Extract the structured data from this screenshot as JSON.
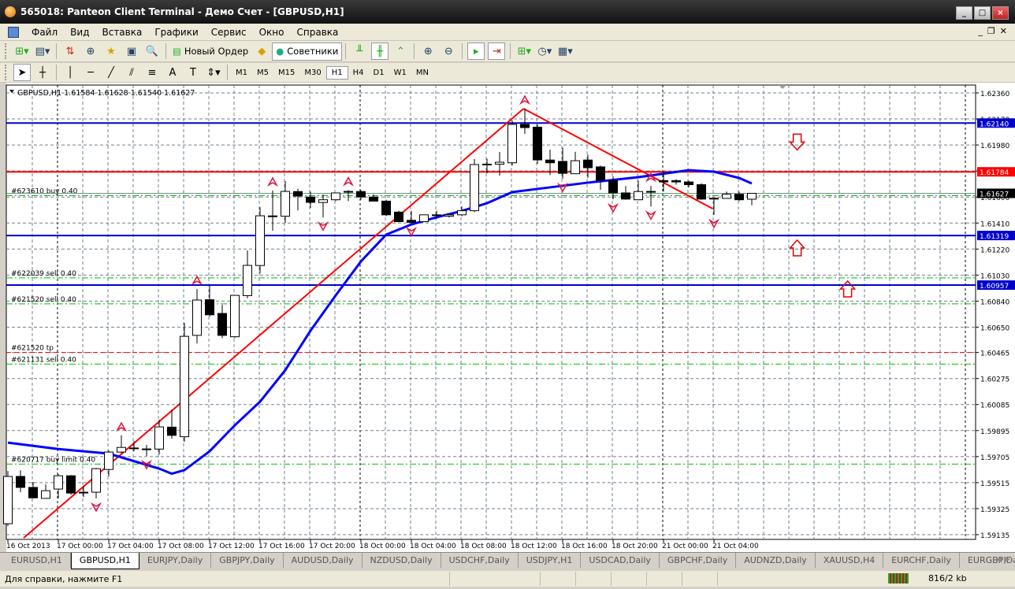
{
  "window": {
    "title": "565018: Panteon Client Terminal - Демо Счет - [GBPUSD,H1]",
    "buttons": [
      "_",
      "□",
      "×"
    ]
  },
  "menu": [
    "Файл",
    "Вид",
    "Вставка",
    "Графики",
    "Сервис",
    "Окно",
    "Справка"
  ],
  "toolbar": {
    "new_order": "Новый Ордер",
    "experts": "Советники"
  },
  "timeframes": [
    "M1",
    "M5",
    "M15",
    "M30",
    "H1",
    "H4",
    "D1",
    "W1",
    "MN"
  ],
  "active_timeframe": "H1",
  "colors": {
    "bull": "#ffffff",
    "bear": "#000000",
    "ma": "#0000ff",
    "trend": "#ff0000",
    "grid": "#708090",
    "order_line": "#00c000",
    "tp_line": "#ff0000"
  },
  "chart_data": {
    "type": "candlestick",
    "header": "GBPUSD,H1  1.61584 1.61628 1.61540 1.61627",
    "symbol": "GBPUSD",
    "timeframe": "H1",
    "ylim": [
      1.59135,
      1.6236
    ],
    "y_ticks": [
      "1.62360",
      "1.62170",
      "1.61980",
      "1.61790",
      "1.61600",
      "1.61410",
      "1.61220",
      "1.61030",
      "1.60840",
      "1.60650",
      "1.60465",
      "1.60275",
      "1.60085",
      "1.59895",
      "1.59705",
      "1.59515",
      "1.59325",
      "1.59135"
    ],
    "x_ticks": [
      "16 Oct 2013",
      "17 Oct 00:00",
      "17 Oct 04:00",
      "17 Oct 08:00",
      "17 Oct 12:00",
      "17 Oct 16:00",
      "17 Oct 20:00",
      "18 Oct 00:00",
      "18 Oct 04:00",
      "18 Oct 08:00",
      "18 Oct 12:00",
      "18 Oct 16:00",
      "18 Oct 20:00",
      "21 Oct 00:00",
      "21 Oct 04:00"
    ],
    "grid": true,
    "ohlc": [
      [
        1.59215,
        1.596,
        1.59197,
        1.5956
      ],
      [
        1.5956,
        1.59606,
        1.59445,
        1.5948
      ],
      [
        1.5948,
        1.5952,
        1.594,
        1.59404
      ],
      [
        1.594,
        1.59502,
        1.594,
        1.59456
      ],
      [
        1.59468,
        1.59577,
        1.594,
        1.59565
      ],
      [
        1.59565,
        1.5957,
        1.59427,
        1.59439
      ],
      [
        1.59445,
        1.59491,
        1.5941,
        1.5944
      ],
      [
        1.59445,
        1.59623,
        1.594,
        1.59617
      ],
      [
        1.59611,
        1.5975,
        1.5956,
        1.59738
      ],
      [
        1.59738,
        1.59859,
        1.5973,
        1.59772
      ],
      [
        1.59767,
        1.59818,
        1.59744,
        1.59768
      ],
      [
        1.5976,
        1.5979,
        1.5971,
        1.59761
      ],
      [
        1.5976,
        1.59974,
        1.5972,
        1.59922
      ],
      [
        1.5992,
        1.60048,
        1.59836,
        1.5986
      ],
      [
        1.5985,
        1.60681,
        1.59813,
        1.60583
      ],
      [
        1.6059,
        1.60928,
        1.60531,
        1.60848
      ],
      [
        1.6085,
        1.60951,
        1.60727,
        1.6074
      ],
      [
        1.6075,
        1.60813,
        1.6057,
        1.6059
      ],
      [
        1.6058,
        1.60882,
        1.6057,
        1.60882
      ],
      [
        1.6088,
        1.6121,
        1.6086,
        1.61101
      ],
      [
        1.611,
        1.61526,
        1.61043,
        1.61463
      ],
      [
        1.6146,
        1.61647,
        1.61354,
        1.61462
      ],
      [
        1.6146,
        1.61716,
        1.6141,
        1.61641
      ],
      [
        1.6164,
        1.6166,
        1.61503,
        1.61607
      ],
      [
        1.616,
        1.6164,
        1.6152,
        1.61561
      ],
      [
        1.6156,
        1.6162,
        1.6145,
        1.6158
      ],
      [
        1.6158,
        1.6163,
        1.6157,
        1.6163
      ],
      [
        1.6164,
        1.6165,
        1.6157,
        1.61641
      ],
      [
        1.6164,
        1.6165,
        1.6158,
        1.616
      ],
      [
        1.616,
        1.6162,
        1.6157,
        1.6157
      ],
      [
        1.6157,
        1.6158,
        1.6146,
        1.6147
      ],
      [
        1.6149,
        1.615,
        1.6142,
        1.6142
      ],
      [
        1.6143,
        1.615,
        1.6141,
        1.61415
      ],
      [
        1.6142,
        1.6146,
        1.6142,
        1.6147
      ],
      [
        1.6147,
        1.615,
        1.6144,
        1.6147
      ],
      [
        1.6146,
        1.6147,
        1.6145,
        1.6147
      ],
      [
        1.6147,
        1.6153,
        1.6146,
        1.615
      ],
      [
        1.615,
        1.61877,
        1.6149,
        1.61837
      ],
      [
        1.6184,
        1.6188,
        1.61773,
        1.61838
      ],
      [
        1.6184,
        1.61929,
        1.61756,
        1.61854
      ],
      [
        1.6185,
        1.62159,
        1.6183,
        1.6213
      ],
      [
        1.6213,
        1.62245,
        1.62061,
        1.62107
      ],
      [
        1.6211,
        1.6213,
        1.61842,
        1.61871
      ],
      [
        1.6187,
        1.61946,
        1.6176,
        1.6185
      ],
      [
        1.6186,
        1.6196,
        1.61733,
        1.61773
      ],
      [
        1.6177,
        1.6193,
        1.6177,
        1.61865
      ],
      [
        1.6187,
        1.6191,
        1.6174,
        1.61814
      ],
      [
        1.6182,
        1.6183,
        1.61653,
        1.61722
      ],
      [
        1.6172,
        1.6175,
        1.61584,
        1.6163
      ],
      [
        1.6163,
        1.6168,
        1.6158,
        1.61585
      ],
      [
        1.6158,
        1.6172,
        1.6158,
        1.6164
      ],
      [
        1.6164,
        1.6168,
        1.6153,
        1.61641
      ],
      [
        1.6172,
        1.61791,
        1.6164,
        1.6171
      ],
      [
        1.6172,
        1.6173,
        1.6169,
        1.6171
      ],
      [
        1.6171,
        1.6172,
        1.6167,
        1.6169
      ],
      [
        1.6169,
        1.617,
        1.6158,
        1.61585
      ],
      [
        1.6159,
        1.6159,
        1.6147,
        1.61591
      ],
      [
        1.6159,
        1.6164,
        1.6159,
        1.6162
      ],
      [
        1.6162,
        1.6164,
        1.6157,
        1.6158
      ],
      [
        1.61584,
        1.61628,
        1.6154,
        1.61627
      ]
    ],
    "moving_average": [
      [
        0,
        1.59807
      ],
      [
        4,
        1.5976
      ],
      [
        8,
        1.59727
      ],
      [
        12,
        1.59617
      ],
      [
        13,
        1.5958
      ],
      [
        14,
        1.59606
      ],
      [
        16,
        1.59744
      ],
      [
        18,
        1.59934
      ],
      [
        20,
        1.60106
      ],
      [
        22,
        1.60336
      ],
      [
        24,
        1.60624
      ],
      [
        26,
        1.60882
      ],
      [
        28,
        1.6113
      ],
      [
        30,
        1.61325
      ],
      [
        32,
        1.614
      ],
      [
        34,
        1.61452
      ],
      [
        36,
        1.61498
      ],
      [
        38,
        1.61555
      ],
      [
        40,
        1.61636
      ],
      [
        42,
        1.61659
      ],
      [
        46,
        1.61705
      ],
      [
        50,
        1.61745
      ],
      [
        54,
        1.61796
      ],
      [
        56,
        1.61785
      ],
      [
        58,
        1.61739
      ],
      [
        59,
        1.61699
      ]
    ],
    "trend_lines": [
      [
        [
          1.25,
          1.59111
        ],
        [
          40.9,
          1.62245
        ]
      ],
      [
        [
          40.9,
          1.62245
        ],
        [
          55.9,
          1.61515
        ]
      ]
    ],
    "horizontal_lines": [
      {
        "price": "1.62140",
        "value": 1.6214,
        "color": "#0000cc"
      },
      {
        "price": "1.61784",
        "value": 1.61784,
        "color": "#ff0000"
      },
      {
        "price": "1.61319",
        "value": 1.61319,
        "color": "#0000cc"
      },
      {
        "price": "1.60957",
        "value": 1.60957,
        "color": "#0000cc"
      }
    ],
    "bid": {
      "price": "1.61627",
      "value": 1.61627
    },
    "orders": [
      {
        "label": "#623610 buy 0.40",
        "value": 1.6161,
        "type": "order"
      },
      {
        "label": "#622039 sell 0.40",
        "value": 1.6101,
        "type": "order"
      },
      {
        "label": "#621520 sell 0.40",
        "value": 1.6082,
        "type": "order"
      },
      {
        "label": "#621520 tp",
        "value": 1.60465,
        "type": "tp"
      },
      {
        "label": "#621131 sell 0.40",
        "value": 1.6038,
        "type": "order"
      },
      {
        "label": "#620717 buy limit 0.40",
        "value": 1.5965,
        "type": "order"
      }
    ],
    "fractals_up": [
      [
        9,
        1.59859
      ],
      [
        15,
        1.60928
      ],
      [
        21,
        1.61647
      ],
      [
        27,
        1.6165
      ],
      [
        41,
        1.62245
      ],
      [
        51,
        1.6168
      ]
    ],
    "fractals_down": [
      [
        7,
        1.594
      ],
      [
        11,
        1.5971
      ],
      [
        25,
        1.6145
      ],
      [
        32,
        1.6141
      ],
      [
        48,
        1.61584
      ],
      [
        51,
        1.6153
      ],
      [
        56,
        1.6147
      ],
      [
        44,
        1.61733
      ]
    ],
    "signal_arrows": [
      {
        "dir": "down",
        "index": 62.6,
        "value": 1.6199
      },
      {
        "dir": "up",
        "index": 62.6,
        "value": 1.6124
      },
      {
        "dir": "up",
        "index": 66.6,
        "value": 1.6094
      }
    ]
  },
  "symbol_tabs": [
    "EURUSD,H1",
    "GBPUSD,H1",
    "EURJPY,Daily",
    "GBPJPY,Daily",
    "AUDUSD,Daily",
    "NZDUSD,Daily",
    "USDCHF,Daily",
    "USDJPY,H1",
    "USDCAD,Daily",
    "GBPCHF,Daily",
    "AUDNZD,Daily",
    "XAUUSD,H4",
    "EURCHF,Daily",
    "EURGBP,Daily"
  ],
  "active_tab": "GBPUSD,H1",
  "status": {
    "help": "Для справки, нажмите F1",
    "traffic": "816/2 kb"
  }
}
